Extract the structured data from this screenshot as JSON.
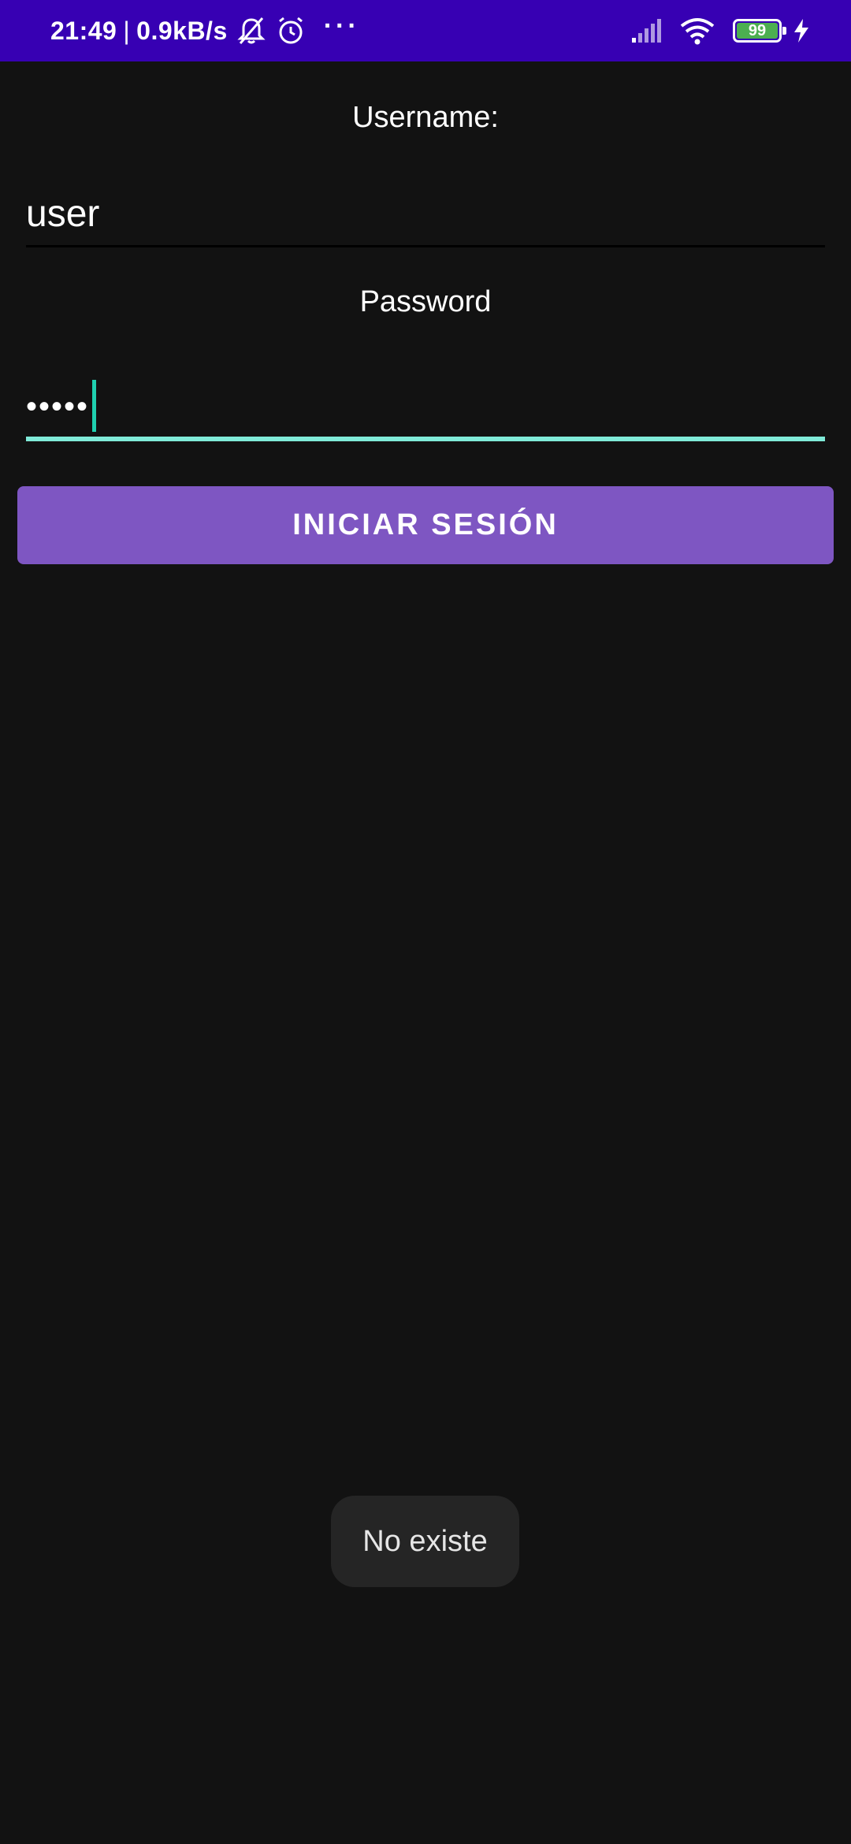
{
  "status_bar": {
    "time": "21:49",
    "separator": "|",
    "network_speed": "0.9kB/s",
    "more_dots": "···",
    "battery_level": "99",
    "icons": [
      "bell-muted-icon",
      "alarm-icon",
      "signal-icon",
      "wifi-icon",
      "battery-icon",
      "charging-icon"
    ],
    "background_color": "#3700b3"
  },
  "form": {
    "username_label": "Username:",
    "username_value": "user",
    "password_label": "Password",
    "password_value": "•••••",
    "login_button_label": "INICIAR SESIÓN",
    "button_color": "#7e56c2",
    "focus_underline_color": "#80ead8"
  },
  "toast": {
    "message": "No existe"
  }
}
